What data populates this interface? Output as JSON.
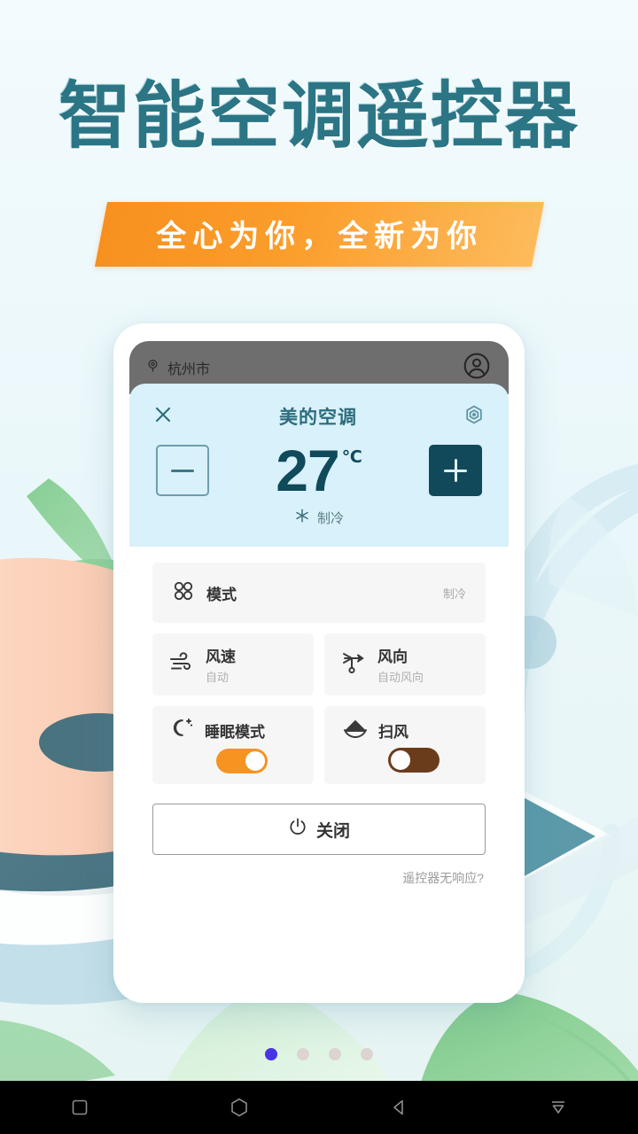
{
  "hero": {
    "title": "智能空调遥控器",
    "subtitle": "全心为你，全新为你",
    "title_color": "#2b7585",
    "banner_color": "#f7901e"
  },
  "phone": {
    "statusbar": {
      "location": "杭州市",
      "location_icon": "location-pin-icon",
      "account_icon": "account-circle-icon"
    },
    "panel": {
      "close_icon": "close-icon",
      "device_name": "美的空调",
      "settings_icon": "hexagon-settings-icon",
      "decrease_label": "−",
      "increase_label": "+",
      "temperature": "27",
      "unit": "℃",
      "mode_icon": "snowflake-icon",
      "mode_text": "制冷"
    },
    "cards": {
      "mode": {
        "icon": "clover-mode-icon",
        "label": "模式",
        "value": "制冷"
      },
      "fan_speed": {
        "icon": "wind-icon",
        "label": "风速",
        "value": "自动"
      },
      "fan_direction": {
        "icon": "wind-vane-icon",
        "label": "风向",
        "value": "自动风向"
      },
      "sleep": {
        "icon": "moon-stars-icon",
        "label": "睡眠模式",
        "state": "on",
        "color": "#f59421"
      },
      "swing": {
        "icon": "swing-arc-icon",
        "label": "扫风",
        "state": "off",
        "color": "#6b3c1c"
      }
    },
    "power_button": {
      "icon": "power-icon",
      "label": "关闭"
    },
    "help_link": "遥控器无响应?"
  },
  "pagination": {
    "total": 4,
    "active_index": 0,
    "active_color": "#4733e8",
    "inactive_color": "#ddd4d2"
  },
  "navbar": {
    "items": [
      {
        "name": "recents-button",
        "icon": "square-icon"
      },
      {
        "name": "home-button",
        "icon": "hexagon-icon"
      },
      {
        "name": "back-button",
        "icon": "triangle-left-icon"
      },
      {
        "name": "hide-keyboard-button",
        "icon": "collapse-down-icon"
      }
    ]
  }
}
